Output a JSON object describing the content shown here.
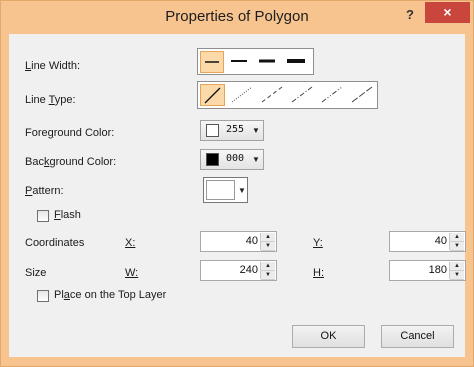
{
  "dialog": {
    "title": "Properties of Polygon",
    "help_label": "?",
    "close_label": "×"
  },
  "line_width": {
    "pre": "",
    "accel": "L",
    "post": "ine Width:"
  },
  "line_type": {
    "pre": "Line ",
    "accel": "T",
    "post": "ype:"
  },
  "foreground": {
    "pre": "Fore",
    "accel": "g",
    "post": "round Color:",
    "value": "255",
    "swatch_color": "#ffffff"
  },
  "background": {
    "pre": "Bac",
    "accel": "k",
    "post": "ground Color:",
    "value": "000",
    "swatch_color": "#000000"
  },
  "pattern": {
    "pre": "",
    "accel": "P",
    "post": "attern:"
  },
  "flash": {
    "pre": "",
    "accel": "F",
    "post": "lash",
    "checked": false
  },
  "coordinates": {
    "label": "Coordinates",
    "x_label": "X:",
    "x_value": "40",
    "y_label": "Y:",
    "y_value": "40"
  },
  "size": {
    "label": "Size",
    "w_label": "W:",
    "w_value": "240",
    "h_label": "H:",
    "h_value": "180"
  },
  "top_layer": {
    "pre": "Pl",
    "accel": "a",
    "post": "ce on the Top Layer",
    "checked": false
  },
  "buttons": {
    "ok": "OK",
    "cancel": "Cancel"
  },
  "colors": {
    "accent": "#f7c48f",
    "close_button": "#c9463d",
    "selected": "#fcd9a9"
  }
}
